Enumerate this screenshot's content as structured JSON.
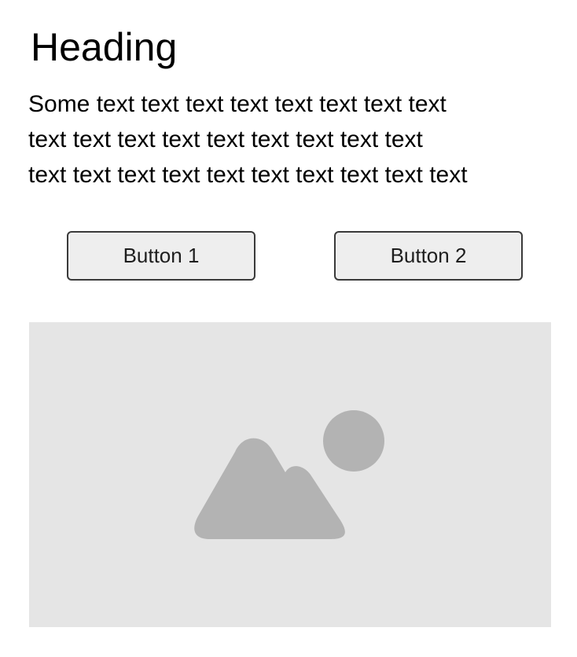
{
  "heading": "Heading",
  "paragraph": {
    "lines": [
      "Some text text text text text text text text",
      "text text text text text text text text text",
      "text text text text text text text text text text"
    ]
  },
  "buttons": {
    "button_1_label": "Button 1",
    "button_2_label": "Button 2"
  },
  "image": {
    "icon": "image-placeholder-icon",
    "background_color": "#e5e5e5",
    "icon_color": "#b3b3b3"
  }
}
